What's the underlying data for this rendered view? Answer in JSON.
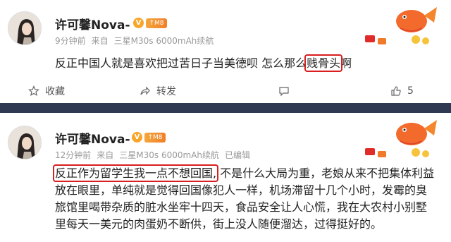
{
  "post1": {
    "username": "许可馨Nova-",
    "vip_badge": "V",
    "level_badge": "↑M8",
    "time": "9分钟前",
    "source_prefix": "来自",
    "device": "三星M30s 6000mAh续航",
    "text_before": "反正中国人就是喜欢把过苦日子当美德呗 怎么那么",
    "text_highlight": "贱骨头",
    "text_after": "啊",
    "actions": {
      "favorite_label": "收藏",
      "forward_label": "转发",
      "comment_label": "",
      "like_count": "5"
    }
  },
  "post2": {
    "username": "许可馨Nova-",
    "vip_badge": "V",
    "level_badge": "↑M8",
    "time": "12分钟前",
    "source_prefix": "来自",
    "device": "三星M30s 6000mAh续航",
    "edited": "已编辑",
    "text_highlight": "反正作为留学生我一点不想回国,",
    "text_rest": " 不是什么大局为重，老娘从来不把集体利益放在眼里，单纯就是觉得回国像犯人一样，机场滞留十几个小时，发霉的臭旅馆里喝带杂质的脏水坐牢十四天，食品安全让人心慌，我在大农村小别墅里每天一美元的肉蛋奶不断供，街上没人随便溜达，过得挺好的。"
  },
  "colors": {
    "highlight_box": "#d81e1e",
    "separator": "#2f3a52",
    "badge_orange": "#f7a62b"
  },
  "icons": [
    "star-icon",
    "forward-icon",
    "comment-icon",
    "like-icon",
    "vip-badge",
    "koi-fish-decoration"
  ]
}
